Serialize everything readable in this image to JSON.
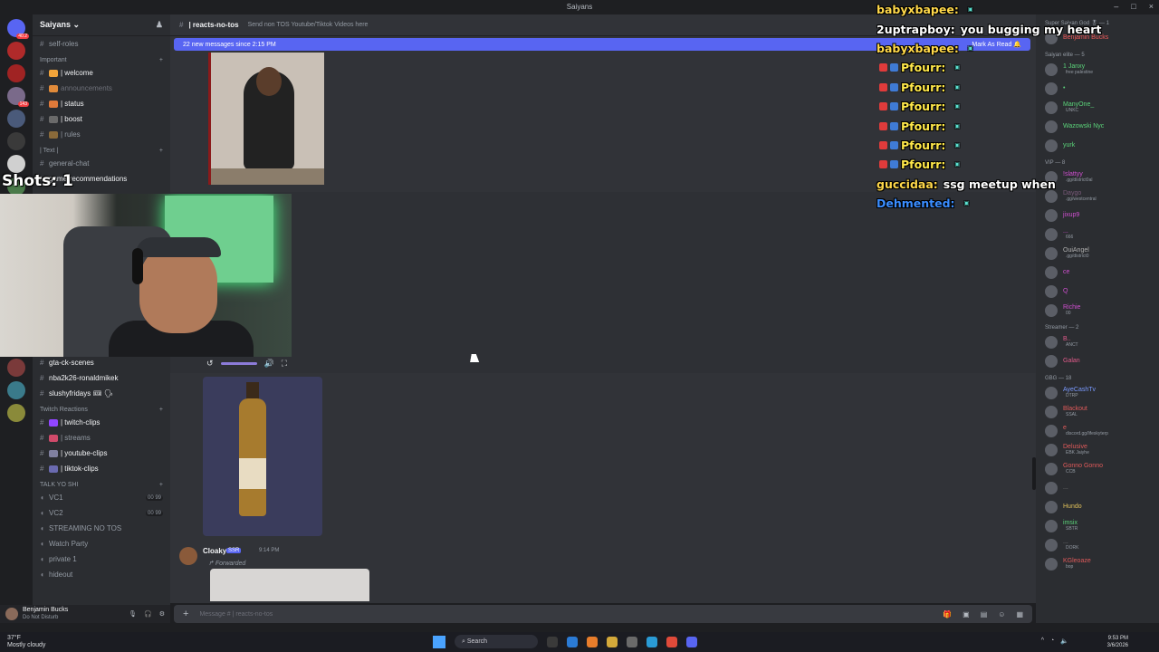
{
  "window": {
    "title": "Saiyans",
    "controls": [
      "–",
      "□",
      "×"
    ]
  },
  "server": {
    "name": "Saiyans ⌄"
  },
  "guild_icons": [
    {
      "color": "#5865f2",
      "badge": "40.2"
    },
    {
      "color": "#b02a2a",
      "badge": ""
    },
    {
      "color": "#a02323",
      "badge": ""
    },
    {
      "color": "#7a6a8a",
      "badge": "143"
    },
    {
      "color": "#4a5a7a",
      "badge": ""
    },
    {
      "color": "#3a3a3a",
      "badge": ""
    },
    {
      "color": "#d0d0d0",
      "badge": ""
    }
  ],
  "sidebar": {
    "top_link": "self-roles",
    "categories": {
      "important": "Important",
      "text": "| Text |",
      "twitch": "Twitch Reactions",
      "talk": "TALK YO SHI"
    },
    "important_channels": [
      {
        "label": "| welcome",
        "color": "#f0a33a",
        "style": "bright"
      },
      {
        "label": "announcements",
        "color": "#e08a3a",
        "style": "dim"
      },
      {
        "label": "| status",
        "color": "#e07a3a",
        "style": "bright"
      },
      {
        "label": "| boost",
        "color": "#6a6a6a",
        "style": "bright"
      },
      {
        "label": "| rules",
        "color": "#8a6a3a",
        "style": "normal"
      }
    ],
    "text_channels": [
      {
        "label": "general-chat",
        "style": "normal"
      },
      {
        "label": "game-recommendations",
        "style": "bright"
      }
    ],
    "lower_channels": [
      {
        "label": "gta-ck-scenes",
        "style": "bright"
      },
      {
        "label": "nba2k26-ronaldmikek",
        "style": "bright"
      },
      {
        "label": "slushyfridays 🎟 🗣",
        "style": "bright"
      }
    ],
    "twitch_channels": [
      {
        "label": "| twitch-clips",
        "color": "#9146ff",
        "style": "bright"
      },
      {
        "label": "| streams",
        "color": "#d04a6a",
        "style": "normal"
      },
      {
        "label": "| youtube-clips",
        "color": "#8080a0",
        "style": "bright"
      },
      {
        "label": "| tiktok-clips",
        "color": "#6a6ab0",
        "style": "bright"
      }
    ],
    "voice_channels": [
      {
        "label": "VC1",
        "count": "00 99"
      },
      {
        "label": "VC2",
        "count": "00 99"
      },
      {
        "label": "STREAMING NO TOS",
        "count": ""
      },
      {
        "label": "Watch Party",
        "count": ""
      },
      {
        "label": "private 1",
        "count": ""
      },
      {
        "label": "hideout",
        "count": ""
      }
    ]
  },
  "user_panel": {
    "name": "Benjamin Bucks",
    "status": "Do Not Disturb"
  },
  "topbar": {
    "channel": "| reacts-no-tos",
    "topic": "Send non TOS Youtube/Tiktok Videos here"
  },
  "newbar": {
    "text": "22 new messages since 2:15 PM",
    "mark": "Mark As Read 🔔"
  },
  "message": {
    "author": "Cloaky",
    "tag": "SSR",
    "time": "9:14 PM",
    "forwarded": "Forwarded"
  },
  "composer": {
    "placeholder": "Message # | reacts-no-tos"
  },
  "stream_overlay": {
    "shots_label": "Shots: 1",
    "chat": [
      {
        "user": "babyxbapee:",
        "text": "",
        "color": "#ffd84a"
      },
      {
        "user": "2uptrapboy:",
        "text": "you bugging my heart",
        "color": "#ffffff"
      },
      {
        "user": "babyxbapee:",
        "text": "",
        "color": "#ffd84a"
      },
      {
        "user": "Pfourr:",
        "text": "",
        "color": "#ffe84a",
        "badges": true
      },
      {
        "user": "Pfourr:",
        "text": "",
        "color": "#ffe84a",
        "badges": true
      },
      {
        "user": "Pfourr:",
        "text": "",
        "color": "#ffe84a",
        "badges": true
      },
      {
        "user": "Pfourr:",
        "text": "",
        "color": "#ffe84a",
        "badges": true
      },
      {
        "user": "Pfourr:",
        "text": "",
        "color": "#ffe84a",
        "badges": true
      },
      {
        "user": "Pfourr:",
        "text": "",
        "color": "#ffe84a",
        "badges": true
      },
      {
        "user": "guccidaa:",
        "text": "ssg meetup when",
        "color": "#ffd84a"
      },
      {
        "user": "Dehmented:",
        "text": "",
        "color": "#3a8dff"
      }
    ]
  },
  "members": {
    "groups": [
      {
        "header": "Super Saiyan God 🎖 — 1",
        "items": [
          {
            "name": "Benjamin Bucks",
            "color": "#f25a5a",
            "sub": ""
          }
        ]
      },
      {
        "header": "Saiyan elite — 5",
        "items": [
          {
            "name": "1 Janxy",
            "color": "#5bd47a",
            "sub": "free palestine"
          },
          {
            "name": "•",
            "color": "#5bd47a",
            "sub": ""
          },
          {
            "name": "ManyOne_",
            "color": "#5bd47a",
            "sub": "UNKC"
          },
          {
            "name": "Wazowski Nyc",
            "color": "#5bd47a",
            "sub": ""
          },
          {
            "name": "yurk",
            "color": "#5bd47a",
            "sub": ""
          }
        ]
      },
      {
        "header": "VIP — 8",
        "items": [
          {
            "name": "!slattyy",
            "color": "#d04fd0",
            "sub": ".gg/district0al"
          },
          {
            "name": "Daygo",
            "color": "#7a5a7a",
            "sub": ".gg/westcentral"
          },
          {
            "name": "jixup9",
            "color": "#d04fd0",
            "sub": ""
          },
          {
            "name": "...",
            "color": "#d04fd0",
            "sub": "666"
          },
          {
            "name": "OuiAngel",
            "color": "#b0b0b0",
            "sub": ".gg/district0"
          },
          {
            "name": "ce",
            "color": "#d04fd0",
            "sub": ""
          },
          {
            "name": "Q",
            "color": "#d04fd0",
            "sub": ""
          },
          {
            "name": "Richie",
            "color": "#d04fd0",
            "sub": "00"
          }
        ]
      },
      {
        "header": "Streamer — 2",
        "items": [
          {
            "name": "B..",
            "color": "#e05a8a",
            "sub": "ANCT"
          },
          {
            "name": "Galan",
            "color": "#e05a8a",
            "sub": ""
          }
        ]
      },
      {
        "header": "GBG — 18",
        "items": [
          {
            "name": "AyeCashTv",
            "color": "#7a9aff",
            "sub": "DTRP"
          },
          {
            "name": "Blackout",
            "color": "#e05a5a",
            "sub": "SSAL"
          },
          {
            "name": "e",
            "color": "#e05a5a",
            "sub": "discord.gg/lifeskyterp"
          },
          {
            "name": "Delusive",
            "color": "#e05a5a",
            "sub": "EBK Jaiyhe"
          },
          {
            "name": "Gonno Gonno",
            "color": "#e05a5a",
            "sub": "CCB"
          },
          {
            "name": "...",
            "color": "#7a7a7a",
            "sub": ""
          },
          {
            "name": "Hundo",
            "color": "#e0c05a",
            "sub": ""
          },
          {
            "name": "imsix",
            "color": "#5bd47a",
            "sub": "SBTR"
          },
          {
            "name": "...",
            "color": "#7a7a7a",
            "sub": "DORK"
          },
          {
            "name": "KGleoaze",
            "color": "#e05a5a",
            "sub": "bop"
          }
        ]
      }
    ]
  },
  "taskbar": {
    "weather_temp": "37°F",
    "weather_desc": "Mostly cloudy",
    "search": "Search",
    "time": "9:53 PM",
    "date": "3/6/2026"
  },
  "accent": "#5865f2"
}
